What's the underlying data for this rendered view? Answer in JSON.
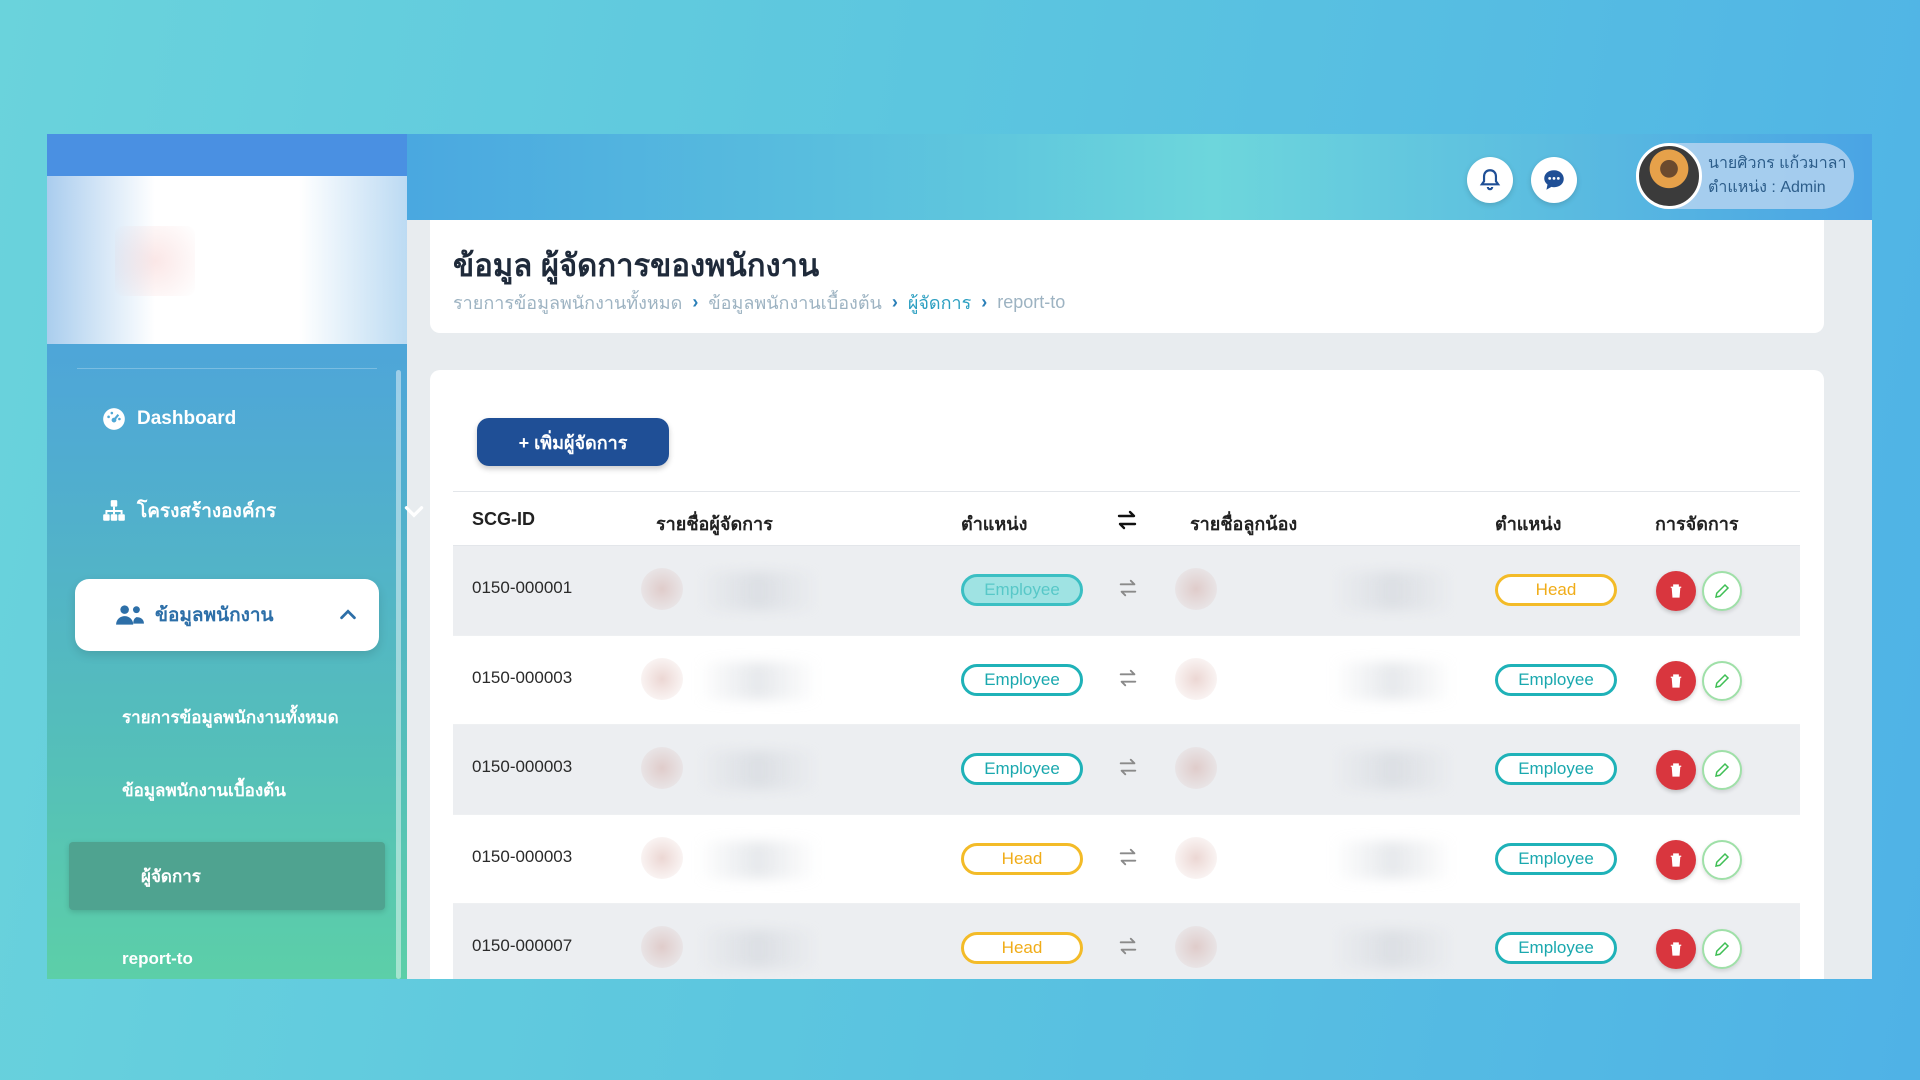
{
  "header": {
    "user_name": "นายศิวกร แก้วมาลา",
    "user_role": "ตำแหน่ง : Admin"
  },
  "sidebar": {
    "items": [
      {
        "label": "Dashboard",
        "icon": "dashboard-icon"
      },
      {
        "label": "โครงสร้างองค์กร",
        "icon": "org-chart-icon"
      },
      {
        "label": "ข้อมูลพนักงาน",
        "icon": "users-icon"
      }
    ],
    "sub_items": [
      {
        "label": "รายการข้อมูลพนักงานทั้งหมด"
      },
      {
        "label": "ข้อมูลพนักงานเบื้องต้น"
      },
      {
        "label": "ผู้จัดการ"
      },
      {
        "label": "report-to"
      }
    ]
  },
  "page": {
    "title": "ข้อมูล ผู้จัดการของพนักงาน",
    "breadcrumb": [
      "รายการข้อมูลพนักงานทั้งหมด",
      "ข้อมูลพนักงานเบื้องต้น",
      "ผู้จัดการ",
      "report-to"
    ],
    "add_button": "+ เพิ่มผู้จัดการ"
  },
  "table": {
    "headers": {
      "scg_id": "SCG-ID",
      "manager_name": "รายชื่อผู้จัดการ",
      "manager_position": "ตำแหน่ง",
      "subordinate_name": "รายชื่อลูกน้อง",
      "subordinate_position": "ตำแหน่ง",
      "actions": "การจัดการ"
    },
    "rows": [
      {
        "id": "0150-000001",
        "manager_position": "Employee",
        "subordinate_position": "Head"
      },
      {
        "id": "0150-000003",
        "manager_position": "Employee",
        "subordinate_position": "Employee"
      },
      {
        "id": "0150-000003",
        "manager_position": "Employee",
        "subordinate_position": "Employee"
      },
      {
        "id": "0150-000003",
        "manager_position": "Head",
        "subordinate_position": "Employee"
      },
      {
        "id": "0150-000007",
        "manager_position": "Head",
        "subordinate_position": "Employee"
      }
    ]
  },
  "colors": {
    "primary": "#1f4f96",
    "employee_badge": "#1fb2b8",
    "head_badge": "#f3bb28",
    "delete": "#d9363e",
    "sidebar_active": "#4fa390"
  }
}
